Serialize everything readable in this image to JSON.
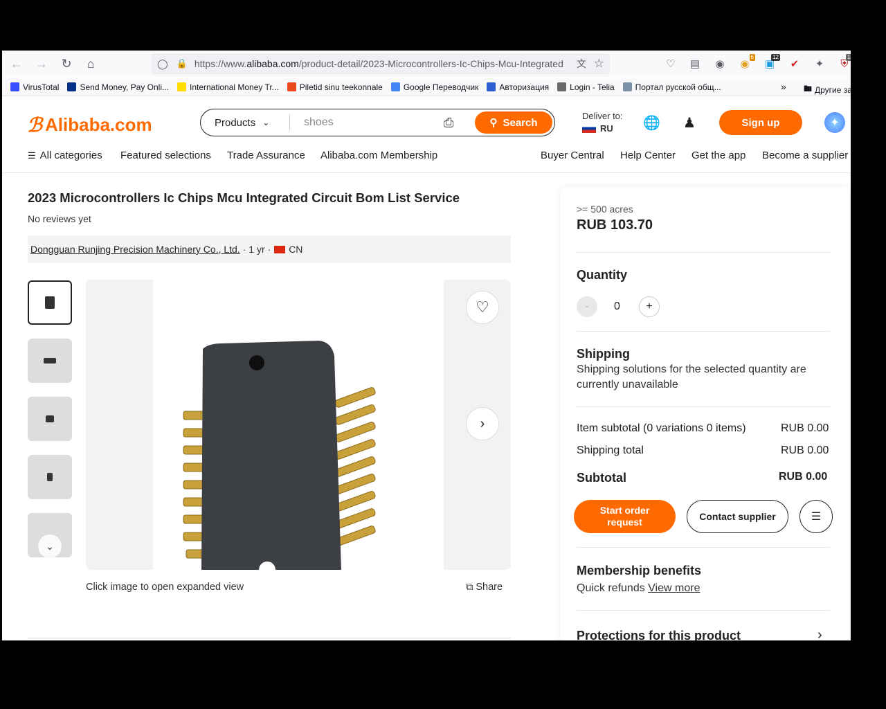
{
  "browser": {
    "url_prefix": "https://www.",
    "url_domain": "alibaba.com",
    "url_path": "/product-detail/2023-Microcontrollers-Ic-Chips-Mcu-Integrated",
    "badges": {
      "ext1": "6",
      "ext2": "12",
      "ext3": "10"
    },
    "bookmarks": [
      {
        "label": "VirusTotal",
        "color": "#394eff"
      },
      {
        "label": "Send Money, Pay Onli...",
        "color": "#003087"
      },
      {
        "label": "International Money Tr...",
        "color": "#ffdd00"
      },
      {
        "label": "Piletid sinu teekonnale",
        "color": "#e8481c"
      },
      {
        "label": "Google Переводчик",
        "color": "#4285f4"
      },
      {
        "label": "Авторизация",
        "color": "#2d5fd3"
      },
      {
        "label": "Login - Telia",
        "color": "#6a6a6a"
      },
      {
        "label": "Портал русской общ...",
        "color": "#7a8fa8"
      }
    ],
    "other_bookmarks": "Другие за"
  },
  "header": {
    "logo": "Alibaba.com",
    "search_category": "Products",
    "search_query": "shoes",
    "search_button": "Search",
    "deliver_label": "Deliver to:",
    "deliver_country": "RU",
    "signup": "Sign up",
    "nav": {
      "all_categories": "All categories",
      "featured": "Featured selections",
      "trade": "Trade Assurance",
      "membership": "Alibaba.com Membership",
      "buyer": "Buyer Central",
      "help": "Help Center",
      "app": "Get the app",
      "supplier": "Become a supplier"
    }
  },
  "product": {
    "title": "2023 Microcontrollers Ic Chips Mcu Integrated Circuit Bom List Service",
    "reviews": "No reviews yet",
    "supplier_name": "Dongguan Runjing Precision Machinery Co., Ltd.",
    "supplier_years": "· 1 yr ·",
    "supplier_country": "CN",
    "caption": "Click image to open expanded view",
    "share": "Share"
  },
  "panel": {
    "moq": ">= 500 acres",
    "price": "RUB 103.70",
    "quantity_label": "Quantity",
    "quantity_value": "0",
    "minus": "-",
    "plus": "+",
    "shipping_title": "Shipping",
    "shipping_text_1": "Shipping solutions for the selected quantity are",
    "shipping_text_2": "currently unavailable",
    "item_subtotal_label": "Item subtotal (0 variations 0 items)",
    "item_subtotal_value": "RUB 0.00",
    "shipping_total_label": "Shipping total",
    "shipping_total_value": "RUB 0.00",
    "subtotal_label": "Subtotal",
    "subtotal_value": "RUB 0.00",
    "order_button_1": "Start order",
    "order_button_2": "request",
    "contact_button": "Contact supplier",
    "membership_title": "Membership benefits",
    "membership_text": "Quick refunds",
    "membership_link": "View more",
    "protections": "Protections for this product"
  },
  "colors": {
    "accent": "#ff6a00"
  }
}
